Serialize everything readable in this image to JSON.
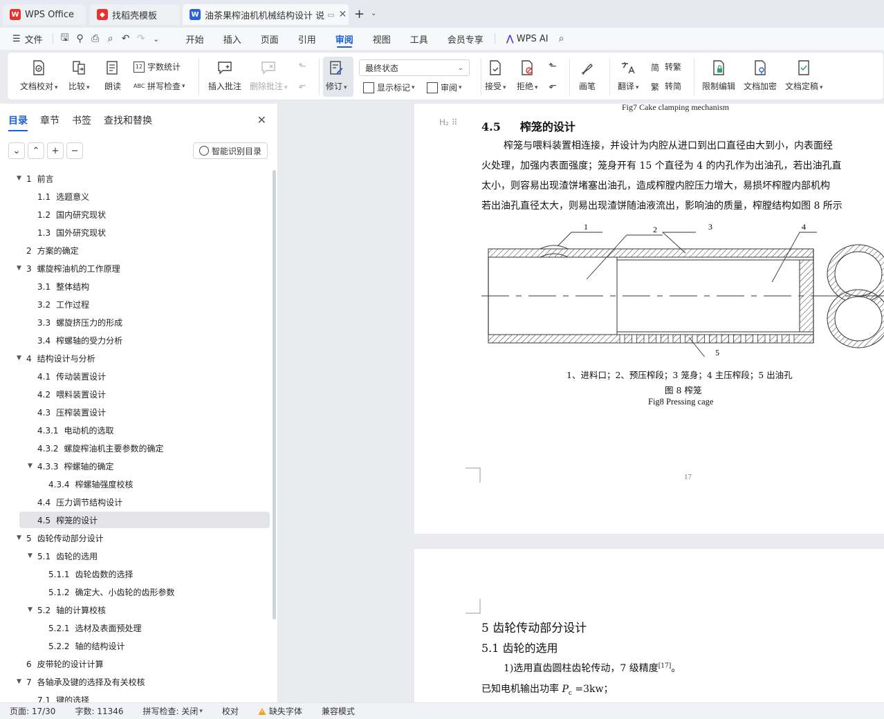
{
  "tabs": [
    {
      "label": "WPS Office",
      "icon": "wps-logo-icon"
    },
    {
      "label": "找稻壳模板",
      "icon": "docer-icon"
    },
    {
      "label": "油茶果榨油机机械结构设计 说",
      "icon": "writer-icon"
    }
  ],
  "menu": {
    "file": "文件",
    "items": [
      "开始",
      "插入",
      "页面",
      "引用",
      "审阅",
      "视图",
      "工具",
      "会员专享"
    ],
    "active": "审阅",
    "wps_ai": "WPS AI"
  },
  "ribbon": {
    "doc_check": "文档校对",
    "compare": "比较",
    "read_aloud": "朗读",
    "word_count": "字数统计",
    "spell_check": "拼写检查",
    "insert_comment": "插入批注",
    "delete_comment": "删除批注",
    "revise": "修订",
    "status_value": "最终状态",
    "show_markup": "显示标记",
    "review": "审阅",
    "accept": "接受",
    "reject": "拒绝",
    "pen": "画笔",
    "translate": "翻译",
    "to_traditional": "转繁",
    "to_simplified": "转简",
    "restrict_edit": "限制编辑",
    "encrypt": "文档加密",
    "finalize": "文档定稿"
  },
  "sidebar": {
    "tabs": [
      "目录",
      "章节",
      "书签",
      "查找和替换"
    ],
    "smart_button": "智能识别目录",
    "toc": [
      {
        "num": "1",
        "text": "前言",
        "level": 0,
        "expander": true
      },
      {
        "num": "1.1",
        "text": "选题意义",
        "level": 1
      },
      {
        "num": "1.2",
        "text": "国内研究现状",
        "level": 1
      },
      {
        "num": "1.3",
        "text": "国外研究现状",
        "level": 1
      },
      {
        "num": "2",
        "text": "方案的确定",
        "level": 0
      },
      {
        "num": "3",
        "text": "螺旋榨油机的工作原理",
        "level": 0,
        "expander": true
      },
      {
        "num": "3.1",
        "text": "整体结构",
        "level": 1
      },
      {
        "num": "3.2",
        "text": "工作过程",
        "level": 1
      },
      {
        "num": "3.3",
        "text": "螺旋挤压力的形成",
        "level": 1
      },
      {
        "num": "3.4",
        "text": "榨螺轴的受力分析",
        "level": 1
      },
      {
        "num": "4",
        "text": "结构设计与分析",
        "level": 0,
        "expander": true
      },
      {
        "num": "4.1",
        "text": "传动装置设计",
        "level": 1
      },
      {
        "num": "4.2",
        "text": "喂料装置设计",
        "level": 1
      },
      {
        "num": "4.3",
        "text": "压榨装置设计",
        "level": 1
      },
      {
        "num": "4.3.1",
        "text": "电动机的选取",
        "level": 1
      },
      {
        "num": "4.3.2",
        "text": "螺旋榨油机主要参数的确定",
        "level": 1
      },
      {
        "num": "4.3.3",
        "text": "榨螺轴的确定",
        "level": 1,
        "expander": true
      },
      {
        "num": "4.3.4",
        "text": "榨螺轴强度校核",
        "level": 2
      },
      {
        "num": "4.4",
        "text": "压力调节结构设计",
        "level": 1
      },
      {
        "num": "4.5",
        "text": "榨笼的设计",
        "level": 1,
        "active": true
      },
      {
        "num": "5",
        "text": "齿轮传动部分设计",
        "level": 0,
        "expander": true
      },
      {
        "num": "5.1",
        "text": "齿轮的选用",
        "level": 1,
        "expander": true
      },
      {
        "num": "5.1.1",
        "text": "齿轮齿数的选择",
        "level": 2
      },
      {
        "num": "5.1.2",
        "text": "确定大、小齿轮的齿形参数",
        "level": 2
      },
      {
        "num": "5.2",
        "text": "轴的计算校核",
        "level": 1,
        "expander": true
      },
      {
        "num": "5.2.1",
        "text": "选材及表面预处理",
        "level": 2
      },
      {
        "num": "5.2.2",
        "text": "轴的结构设计",
        "level": 2
      },
      {
        "num": "6",
        "text": "皮带轮的设计计算",
        "level": 0
      },
      {
        "num": "7",
        "text": "各轴承及键的选择及有关校核",
        "level": 0,
        "expander": true
      },
      {
        "num": "7.1",
        "text": "键的选择",
        "level": 1
      }
    ]
  },
  "document": {
    "fig7_caption": "Fig7    Cake clamping mechanism",
    "heading_marker": "H₂",
    "section_45_num": "4.5",
    "section_45_title": "榨笼的设计",
    "para_lines": [
      "榨笼与喂料装置相连接，并设计为内腔从进口到出口直径由大到小，内表面经",
      "火处理，加强内表面强度；笼身开有 15 个直径为 4 的内孔作为出油孔，若出油孔直",
      "太小，则容易出现渣饼堵塞出油孔，造成榨膛内腔压力增大，易损坏榨膛内部机构",
      "若出油孔直径太大，则易出现渣饼随油液流出，影响油的质量，榨膛结构如图 8 所示"
    ],
    "drawing_labels": [
      "1",
      "2",
      "3",
      "4",
      "5"
    ],
    "fig8_legend": "1、进料口；2、预压榨段；3 笼身；4 主压榨段；5 出油孔",
    "fig8_title": "图 8    榨笼",
    "fig8_en": "Fig8    Pressing cage",
    "page_number": "17",
    "section_5": "5    齿轮传动部分设计",
    "section_51": "5.1    齿轮的选用",
    "gear_line_text": "1)选用直齿圆柱齿轮传动，7 级精度",
    "gear_ref": "[17]",
    "gear_line_end": "。",
    "power_line_prefix": "已知电机输出功率 ",
    "power_var": "P",
    "power_sub": "c",
    "power_value": " =3kw；"
  },
  "status": {
    "page": "页面: 17/30",
    "words": "字数: 11346",
    "spell": "拼写检查: 关闭",
    "proof": "校对",
    "missing_font": "缺失字体",
    "compat": "兼容模式"
  },
  "colors": {
    "accent": "#1a5fd6",
    "wps_red": "#e8322e",
    "writer_blue": "#2a62d9"
  }
}
